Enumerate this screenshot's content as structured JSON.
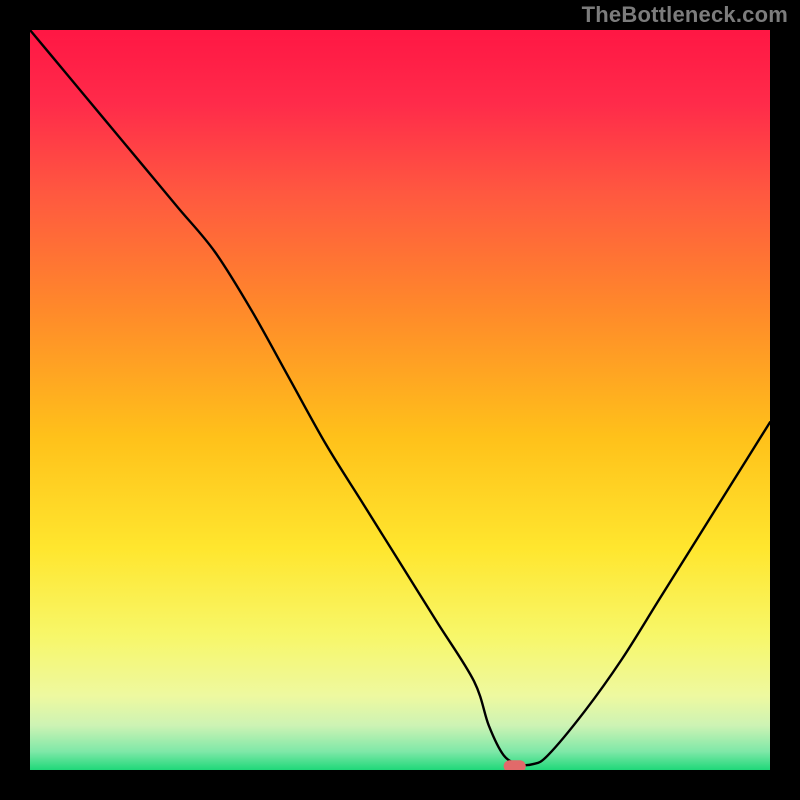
{
  "watermark": "TheBottleneck.com",
  "chart_data": {
    "type": "line",
    "title": "",
    "xlabel": "",
    "ylabel": "",
    "xlim": [
      0,
      100
    ],
    "ylim": [
      0,
      100
    ],
    "x": [
      0,
      5,
      10,
      15,
      20,
      25,
      30,
      35,
      40,
      45,
      50,
      55,
      60,
      62,
      64,
      66,
      68,
      70,
      75,
      80,
      85,
      90,
      95,
      100
    ],
    "values": [
      100,
      94,
      88,
      82,
      76,
      70,
      62,
      53,
      44,
      36,
      28,
      20,
      12,
      6,
      2,
      0.8,
      0.8,
      2,
      8,
      15,
      23,
      31,
      39,
      47
    ],
    "marker": {
      "x_start": 64,
      "x_end": 67,
      "y": 0.5,
      "color": "#e26a6a"
    },
    "gradient_stops": [
      {
        "offset": 0.0,
        "color": "#ff1744"
      },
      {
        "offset": 0.1,
        "color": "#ff2b4a"
      },
      {
        "offset": 0.22,
        "color": "#ff5840"
      },
      {
        "offset": 0.38,
        "color": "#ff8a2a"
      },
      {
        "offset": 0.55,
        "color": "#ffc11a"
      },
      {
        "offset": 0.7,
        "color": "#ffe62e"
      },
      {
        "offset": 0.82,
        "color": "#f7f76a"
      },
      {
        "offset": 0.9,
        "color": "#eef9a0"
      },
      {
        "offset": 0.94,
        "color": "#cdf3b4"
      },
      {
        "offset": 0.975,
        "color": "#7fe8a8"
      },
      {
        "offset": 1.0,
        "color": "#1fd879"
      }
    ]
  }
}
